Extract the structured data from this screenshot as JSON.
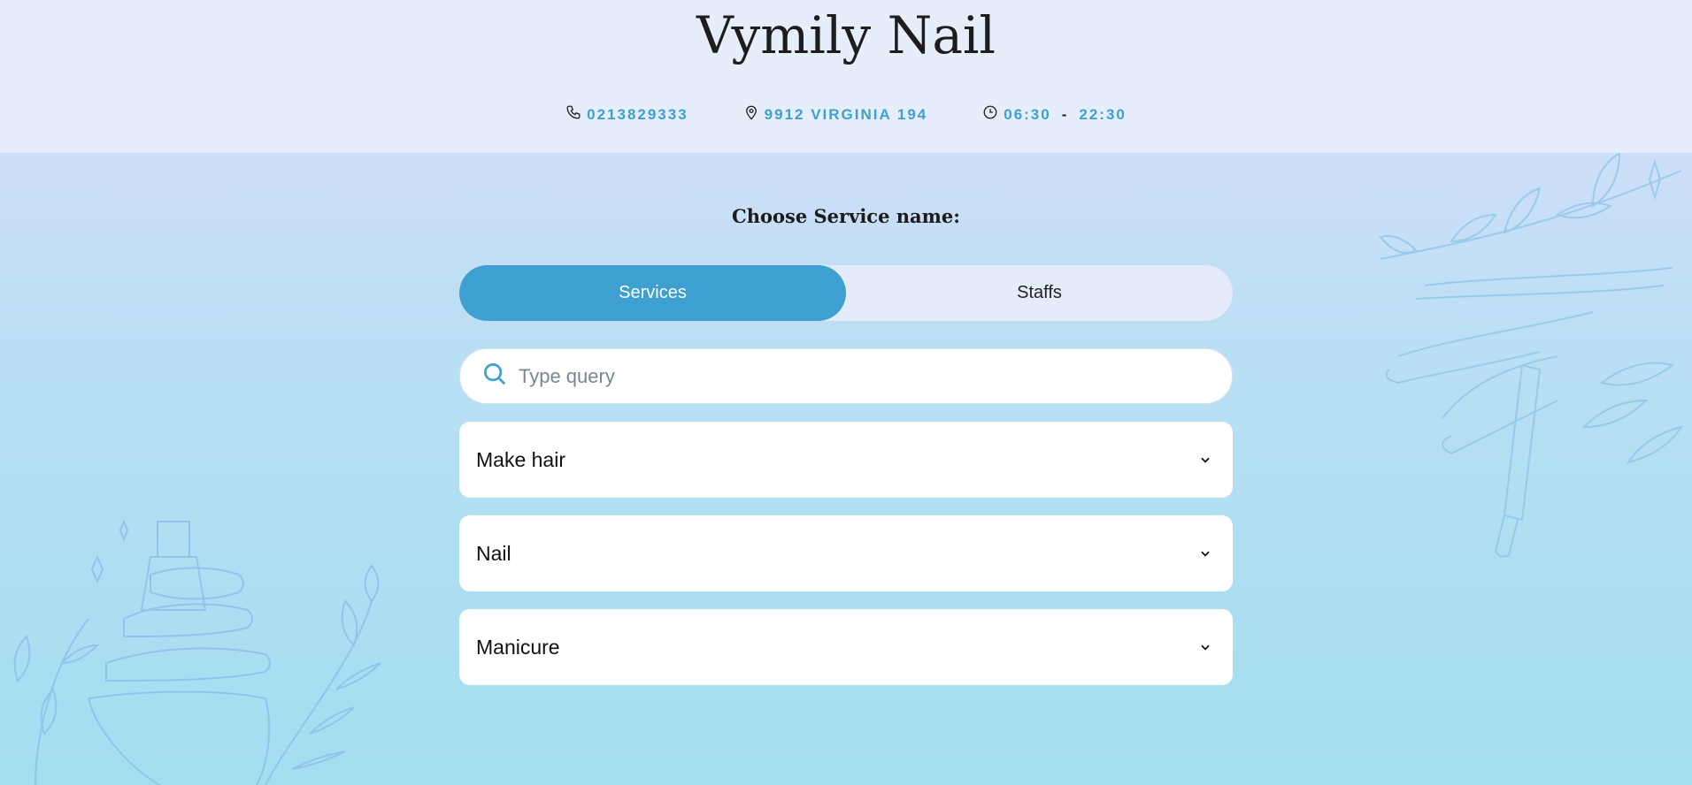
{
  "header": {
    "brand": "Vymily Nail",
    "phone": "0213829333",
    "address": "9912 VIRGINIA 194",
    "hours_open": "06:30",
    "hours_sep": "-",
    "hours_close": "22:30"
  },
  "main": {
    "title": "Choose Service name:",
    "tabs": [
      {
        "label": "Services",
        "active": true
      },
      {
        "label": "Staffs",
        "active": false
      }
    ],
    "search": {
      "placeholder": "Type query",
      "value": ""
    },
    "categories": [
      {
        "label": "Make hair"
      },
      {
        "label": "Nail"
      },
      {
        "label": "Manicure"
      }
    ]
  },
  "colors": {
    "accent": "#3da0d0",
    "header_bg": "#e6eefc",
    "toggle_bg": "#e4ecfb",
    "page_gradient_top": "#cfdff8",
    "page_gradient_bottom": "#a2def0"
  },
  "icons": [
    "phone-icon",
    "location-pin-icon",
    "clock-icon",
    "search-icon",
    "chevron-down-icon",
    "nail-polish-hand-illustration",
    "leaf-branch-illustration"
  ]
}
